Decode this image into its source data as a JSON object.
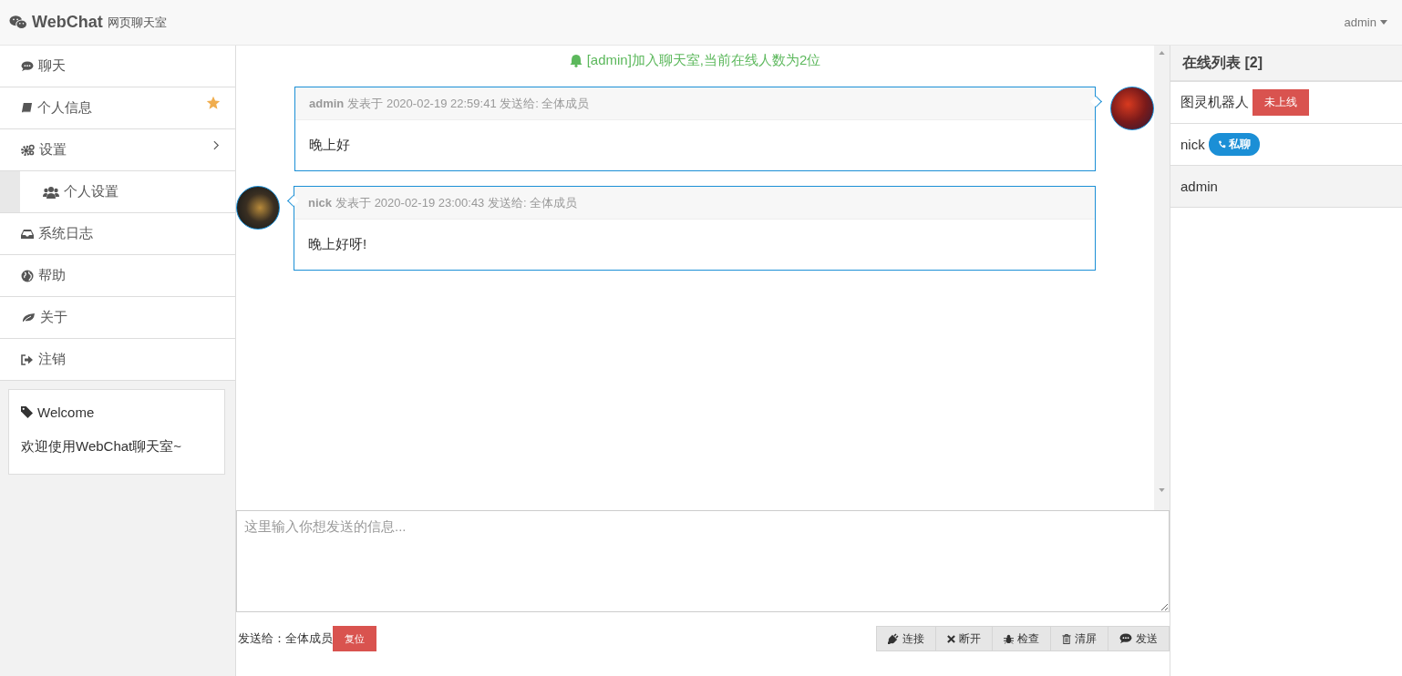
{
  "header": {
    "brand": "WebChat",
    "subtitle": "网页聊天室",
    "user_menu": "admin"
  },
  "sidebar": {
    "items": [
      {
        "label": "聊天",
        "starred": false
      },
      {
        "label": "个人信息",
        "starred": true
      },
      {
        "label": "设置",
        "starred": false,
        "expanded": true,
        "children": [
          {
            "label": "个人设置",
            "starred": false
          }
        ]
      },
      {
        "label": "系统日志",
        "starred": false
      },
      {
        "label": "帮助",
        "starred": false
      },
      {
        "label": "关于",
        "starred": false
      },
      {
        "label": "注销",
        "starred": false
      }
    ],
    "welcome_card": {
      "title": "Welcome",
      "text": "欢迎使用WebChat聊天室~"
    }
  },
  "chat": {
    "notice": "[admin]加入聊天室,当前在线人数为2位",
    "messages": [
      {
        "kind": "outgoing",
        "sender": "admin",
        "meta": "发表于 2020-02-19 22:59:41 发送给: 全体成员",
        "text": "晚上好"
      },
      {
        "kind": "incoming",
        "sender": "nick",
        "meta": "发表于 2020-02-19 23:00:43 发送给: 全体成员",
        "text": "晚上好呀!"
      }
    ],
    "input": {
      "placeholder": "这里输入你想发送的信息..."
    },
    "recipient": "发送给：全体成员",
    "reset_button": "复位",
    "toolbar": [
      {
        "label": "连接"
      },
      {
        "label": "断开"
      },
      {
        "label": "检查"
      },
      {
        "label": "清屏"
      },
      {
        "label": "发送"
      }
    ]
  },
  "online": {
    "title": "在线列表 [2]",
    "users": [
      {
        "name": "图灵机器人",
        "kind": "offline",
        "badge": "未上线",
        "selected": false
      },
      {
        "name": "nick",
        "kind": "chat",
        "badge": "私聊",
        "selected": false
      },
      {
        "name": "admin",
        "kind": "plain",
        "selected": true
      }
    ]
  }
}
